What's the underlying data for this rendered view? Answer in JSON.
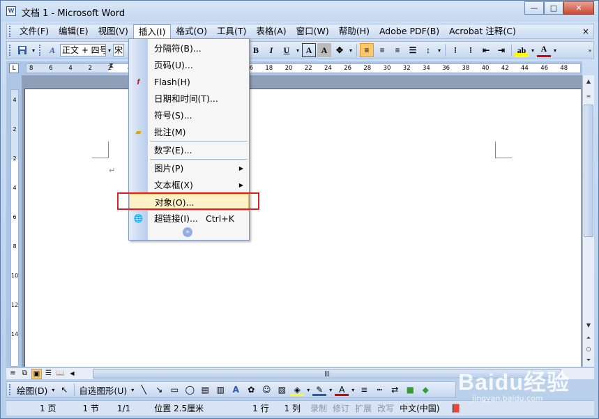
{
  "window": {
    "title": "文档 1 - Microsoft Word",
    "min_label": "—",
    "max_label": "□",
    "close_label": "✕"
  },
  "menubar": {
    "items": [
      "文件(F)",
      "编辑(E)",
      "视图(V)",
      "插入(I)",
      "格式(O)",
      "工具(T)",
      "表格(A)",
      "窗口(W)",
      "帮助(H)",
      "Adobe PDF(B)",
      "Acrobat 注释(C)"
    ],
    "active": "插入(I)",
    "close_doc": "×"
  },
  "toolbar": {
    "style_value": "正文 + 四号",
    "font_value": "宋",
    "bold": "B",
    "italic": "I",
    "underline": "U",
    "char_border": "A",
    "char_shade": "A"
  },
  "ruler": {
    "numbers": [
      "8",
      "6",
      "4",
      "2",
      "2",
      "4",
      "6",
      "8",
      "10",
      "12",
      "14",
      "16",
      "18",
      "20",
      "22",
      "24",
      "26",
      "28",
      "30",
      "32",
      "34",
      "36",
      "38",
      "40",
      "42",
      "44",
      "46",
      "48"
    ]
  },
  "vruler": {
    "numbers": [
      "4",
      "2",
      "2",
      "4",
      "6",
      "8",
      "10",
      "12",
      "14"
    ]
  },
  "insert_menu": {
    "items": [
      {
        "label": "分隔符(B)...",
        "icon": ""
      },
      {
        "label": "页码(U)...",
        "icon": ""
      },
      {
        "label": "Flash(H)",
        "icon": "flash-icon"
      },
      {
        "label": "日期和时间(T)...",
        "icon": ""
      },
      {
        "label": "符号(S)...",
        "icon": ""
      },
      {
        "label": "批注(M)",
        "icon": "comment-folder-icon"
      },
      {
        "label": "数字(E)...",
        "icon": ""
      },
      {
        "label": "图片(P)",
        "icon": "",
        "submenu": true
      },
      {
        "label": "文本框(X)",
        "icon": "",
        "submenu": true
      },
      {
        "label": "对象(O)...",
        "icon": "",
        "highlighted": true
      },
      {
        "label": "超链接(I)...",
        "icon": "hyperlink-globe-icon",
        "shortcut": "Ctrl+K"
      }
    ],
    "expand": "»"
  },
  "drawbar": {
    "draw_label": "绘图(D)",
    "autoshapes_label": "自选图形(U)"
  },
  "statusbar": {
    "page": "1 页",
    "section": "1 节",
    "page_of": "1/1",
    "position": "位置 2.5厘米",
    "line": "1 行",
    "column": "1 列",
    "rec": "录制",
    "trk": "修订",
    "ext": "扩展",
    "ovr": "改写",
    "language": "中文(中国)"
  },
  "watermark": {
    "logo": "Baidu经验",
    "url": "jingyan.baidu.com"
  }
}
